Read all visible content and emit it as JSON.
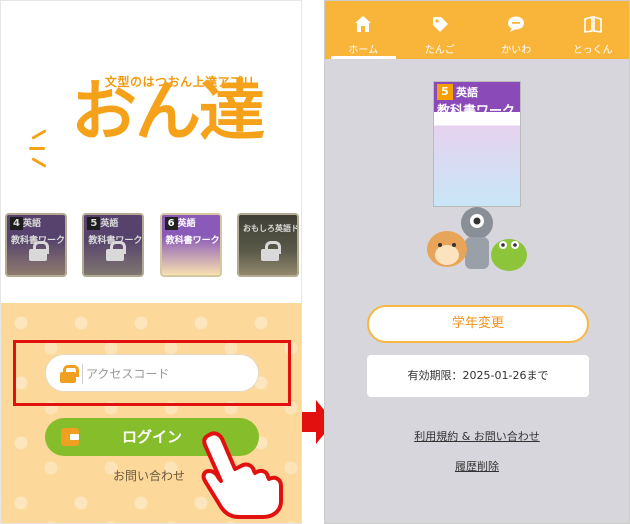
{
  "login_screen": {
    "logo_tagline": "文型のはつおん上達アプリ",
    "logo_text": "おん達",
    "books": [
      {
        "grade": "4",
        "title": "英語",
        "subtitle": "教科書ワーク",
        "locked": true
      },
      {
        "grade": "5",
        "title": "英語",
        "subtitle": "教科書ワーク",
        "locked": true
      },
      {
        "grade": "6",
        "title": "英語",
        "subtitle": "教科書ワーク",
        "locked": false
      },
      {
        "grade": "",
        "title": "",
        "subtitle": "おもしろ英語ドリル",
        "locked": true
      }
    ],
    "access_code_placeholder": "アクセスコード",
    "login_label": "ログイン",
    "contact_label": "お問い合わせ"
  },
  "home_screen": {
    "tabs": [
      {
        "label": "ホーム",
        "icon": "home-icon",
        "active": true
      },
      {
        "label": "たんご",
        "icon": "tag-icon",
        "active": false
      },
      {
        "label": "かいわ",
        "icon": "chat-bubble-icon",
        "active": false
      },
      {
        "label": "とっくん",
        "icon": "book-open-icon",
        "active": false
      }
    ],
    "book_cover": {
      "grade": "5",
      "title": "英語",
      "subtitle": "教科書ワーク"
    },
    "grade_change_label": "学年変更",
    "expiry_text": "有効期限：2025-01-26まで",
    "terms_link": "利用規約 & お問い合わせ",
    "history_link": "履歴削除"
  },
  "colors": {
    "accent_orange": "#f9b53a",
    "login_green": "#86bd2a",
    "highlight_red": "#e31010",
    "background_gray": "#d7d6dd"
  }
}
